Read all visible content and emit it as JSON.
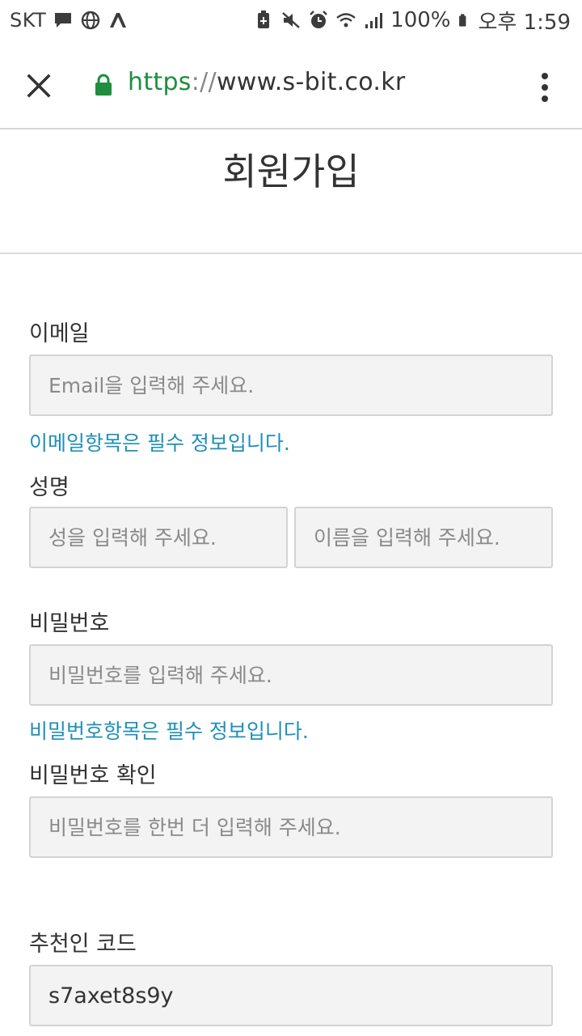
{
  "status_bar": {
    "carrier": "SKT",
    "battery": "100%",
    "time": "오후 1:59"
  },
  "url_bar": {
    "scheme": "https",
    "separator": "://",
    "host": "www.s-bit.co.kr",
    "secure_color": "#1e8e3e"
  },
  "page": {
    "title": "회원가입"
  },
  "form": {
    "email": {
      "label": "이메일",
      "placeholder": "Email을 입력해 주세요.",
      "value": "",
      "error": "이메일항목은 필수 정보입니다."
    },
    "name": {
      "label": "성명",
      "last_placeholder": "성을 입력해 주세요.",
      "first_placeholder": "이름을 입력해 주세요."
    },
    "password": {
      "label": "비밀번호",
      "placeholder": "비밀번호를 입력해 주세요.",
      "error": "비밀번호항목은 필수 정보입니다."
    },
    "password_confirm": {
      "label": "비밀번호 확인",
      "placeholder": "비밀번호를 한번 더 입력해 주세요."
    },
    "referral": {
      "label": "추천인 코드",
      "value": "s7axet8s9y"
    }
  },
  "colors": {
    "hint": "#1f8fb8",
    "field_bg": "#f3f3f3",
    "field_border": "#d3d3d3"
  }
}
